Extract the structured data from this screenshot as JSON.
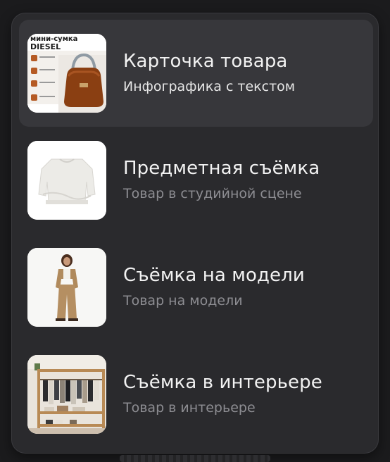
{
  "menu": {
    "items": [
      {
        "title": "Карточка товара",
        "subtitle": "Инфографика с текстом",
        "thumbnail_icon": "product-card-infographic-thumbnail",
        "thumbnail_text": {
          "line1": "мини-сумка",
          "line2": "DIESEL"
        },
        "active": true
      },
      {
        "title": "Предметная съёмка",
        "subtitle": "Товар в студийной сцене",
        "thumbnail_icon": "studio-sweater-thumbnail",
        "active": false
      },
      {
        "title": "Съёмка на модели",
        "subtitle": "Товар на модели",
        "thumbnail_icon": "model-photo-thumbnail",
        "active": false
      },
      {
        "title": "Съёмка в интерьере",
        "subtitle": "Товар в интерьере",
        "thumbnail_icon": "interior-wardrobe-thumbnail",
        "active": false
      }
    ]
  },
  "colors": {
    "background": "#1b1b1d",
    "panel": "#2a2a2d",
    "active_item": "#37373b",
    "title": "#f2f2f2",
    "subtitle": "#8d8d92"
  }
}
